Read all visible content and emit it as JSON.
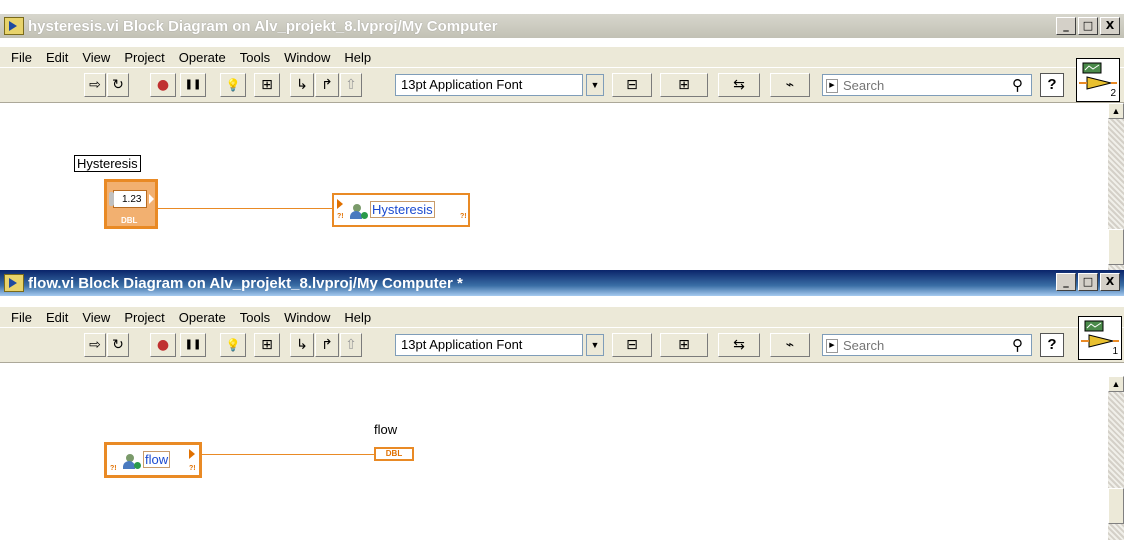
{
  "windows": [
    {
      "title": "hysteresis.vi Block Diagram on Alv_projekt_8.lvproj/My Computer",
      "menu": [
        "File",
        "Edit",
        "View",
        "Project",
        "Operate",
        "Tools",
        "Window",
        "Help"
      ],
      "font_select": "13pt Application Font",
      "search_placeholder": "Search",
      "icon_number": "2",
      "diagram": {
        "control_label": "Hysteresis",
        "control_value": "1.23",
        "control_type": "DBL",
        "variable_label": "Hysteresis"
      }
    },
    {
      "title": "flow.vi Block Diagram on Alv_projekt_8.lvproj/My Computer *",
      "menu": [
        "File",
        "Edit",
        "View",
        "Project",
        "Operate",
        "Tools",
        "Window",
        "Help"
      ],
      "font_select": "13pt Application Font",
      "search_placeholder": "Search",
      "icon_number": "1",
      "diagram": {
        "variable_label": "flow",
        "indicator_label": "flow",
        "indicator_type": "DBL"
      }
    }
  ],
  "window_buttons": {
    "minimize": "_",
    "maximize": "□",
    "close": "X"
  },
  "toolbar_glyphs": {
    "run": "⇨",
    "run_continuously": "↻",
    "abort": "●",
    "pause": "❚❚",
    "highlight": "💡",
    "retain": "⊞",
    "step_into": "↳",
    "step_over": "↱",
    "step_out": "⇧",
    "align": "⊟",
    "distribute": "⊞",
    "reorder": "⇆",
    "cleanup": "⌁",
    "help": "?"
  },
  "colors": {
    "wire": "#e98a25",
    "active_title": "#0a246a",
    "inactive_title": "#c2c1b5"
  }
}
